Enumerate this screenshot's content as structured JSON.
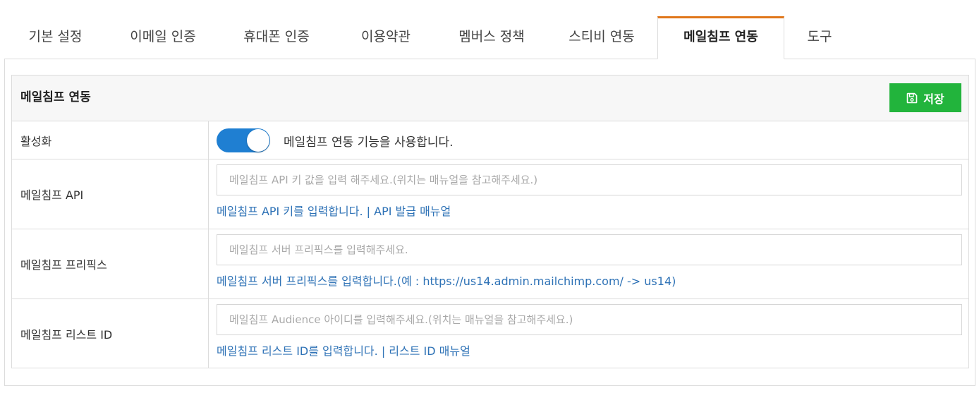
{
  "tabs": [
    {
      "label": "기본 설정"
    },
    {
      "label": "이메일 인증"
    },
    {
      "label": "휴대폰 인증"
    },
    {
      "label": "이용약관"
    },
    {
      "label": "멤버스 정책"
    },
    {
      "label": "스티비 연동"
    },
    {
      "label": "메일침프 연동",
      "active": true
    },
    {
      "label": "도구"
    }
  ],
  "colors": {
    "active_tab_accent": "#e0761a",
    "save_button": "#22b43c",
    "toggle_on": "#1f7fd2",
    "link": "#2e72b6"
  },
  "section": {
    "title": "메일침프 연동",
    "save_label": "저장",
    "save_icon": "floppy-disk-icon"
  },
  "rows": {
    "activate": {
      "label": "활성화",
      "toggle_on": true,
      "description": "메일침프 연동 기능을 사용합니다."
    },
    "api": {
      "label": "메일침프 API",
      "value": "",
      "placeholder": "메일침프 API 키 값을 입력 해주세요.(위치는 매뉴얼을 참고해주세요.)",
      "help": "메일침프 API 키를 입력합니다. | API 발급 매뉴얼"
    },
    "prefix": {
      "label": "메일침프 프리픽스",
      "value": "",
      "placeholder": "메일침프 서버 프리픽스를 입력해주세요.",
      "help": "메일침프 서버 프리픽스를 입력합니다.(예 : https://us14.admin.mailchimp.com/ -> us14)"
    },
    "list_id": {
      "label": "메일침프 리스트 ID",
      "value": "",
      "placeholder": "메일침프 Audience 아이디를 입력해주세요.(위치는 매뉴얼을 참고해주세요.)",
      "help": "메일침프 리스트 ID를 입력합니다. | 리스트 ID 매뉴얼"
    }
  }
}
